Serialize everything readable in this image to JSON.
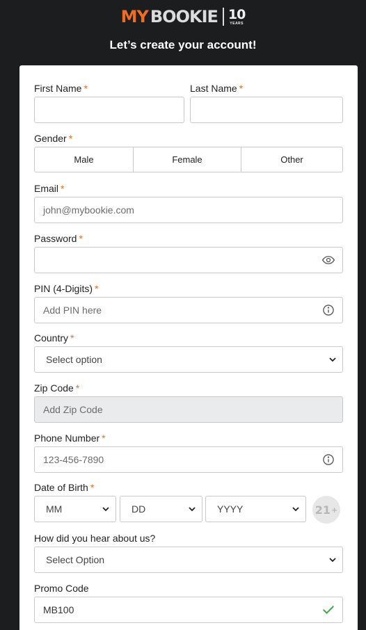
{
  "logo": {
    "part1": "MY",
    "part2": "BOOKIE",
    "years_num": "10",
    "years_label": "YEARS"
  },
  "page_title": "Let’s create your account!",
  "required_mark": "*",
  "form": {
    "first_name": {
      "label": "First Name",
      "value": ""
    },
    "last_name": {
      "label": "Last Name",
      "value": ""
    },
    "gender": {
      "label": "Gender",
      "options": [
        "Male",
        "Female",
        "Other"
      ]
    },
    "email": {
      "label": "Email",
      "placeholder": "john@mybookie.com"
    },
    "password": {
      "label": "Password",
      "value": ""
    },
    "pin": {
      "label": "PIN (4-Digits)",
      "placeholder": "Add PIN here"
    },
    "country": {
      "label": "Country",
      "selected": "Select option"
    },
    "zip": {
      "label": "Zip Code",
      "placeholder": "Add Zip Code"
    },
    "phone": {
      "label": "Phone Number",
      "placeholder": "123-456-7890"
    },
    "dob": {
      "label": "Date of Birth",
      "month": "MM",
      "day": "DD",
      "year": "YYYY",
      "age_badge": "21",
      "age_plus": "+"
    },
    "hear_about": {
      "label": "How did you hear about us?",
      "selected": "Select Option"
    },
    "promo": {
      "label": "Promo Code",
      "value": "MB100"
    }
  },
  "colors": {
    "accent": "#f26b21",
    "success": "#3fae49",
    "background": "#1c1d1f"
  }
}
